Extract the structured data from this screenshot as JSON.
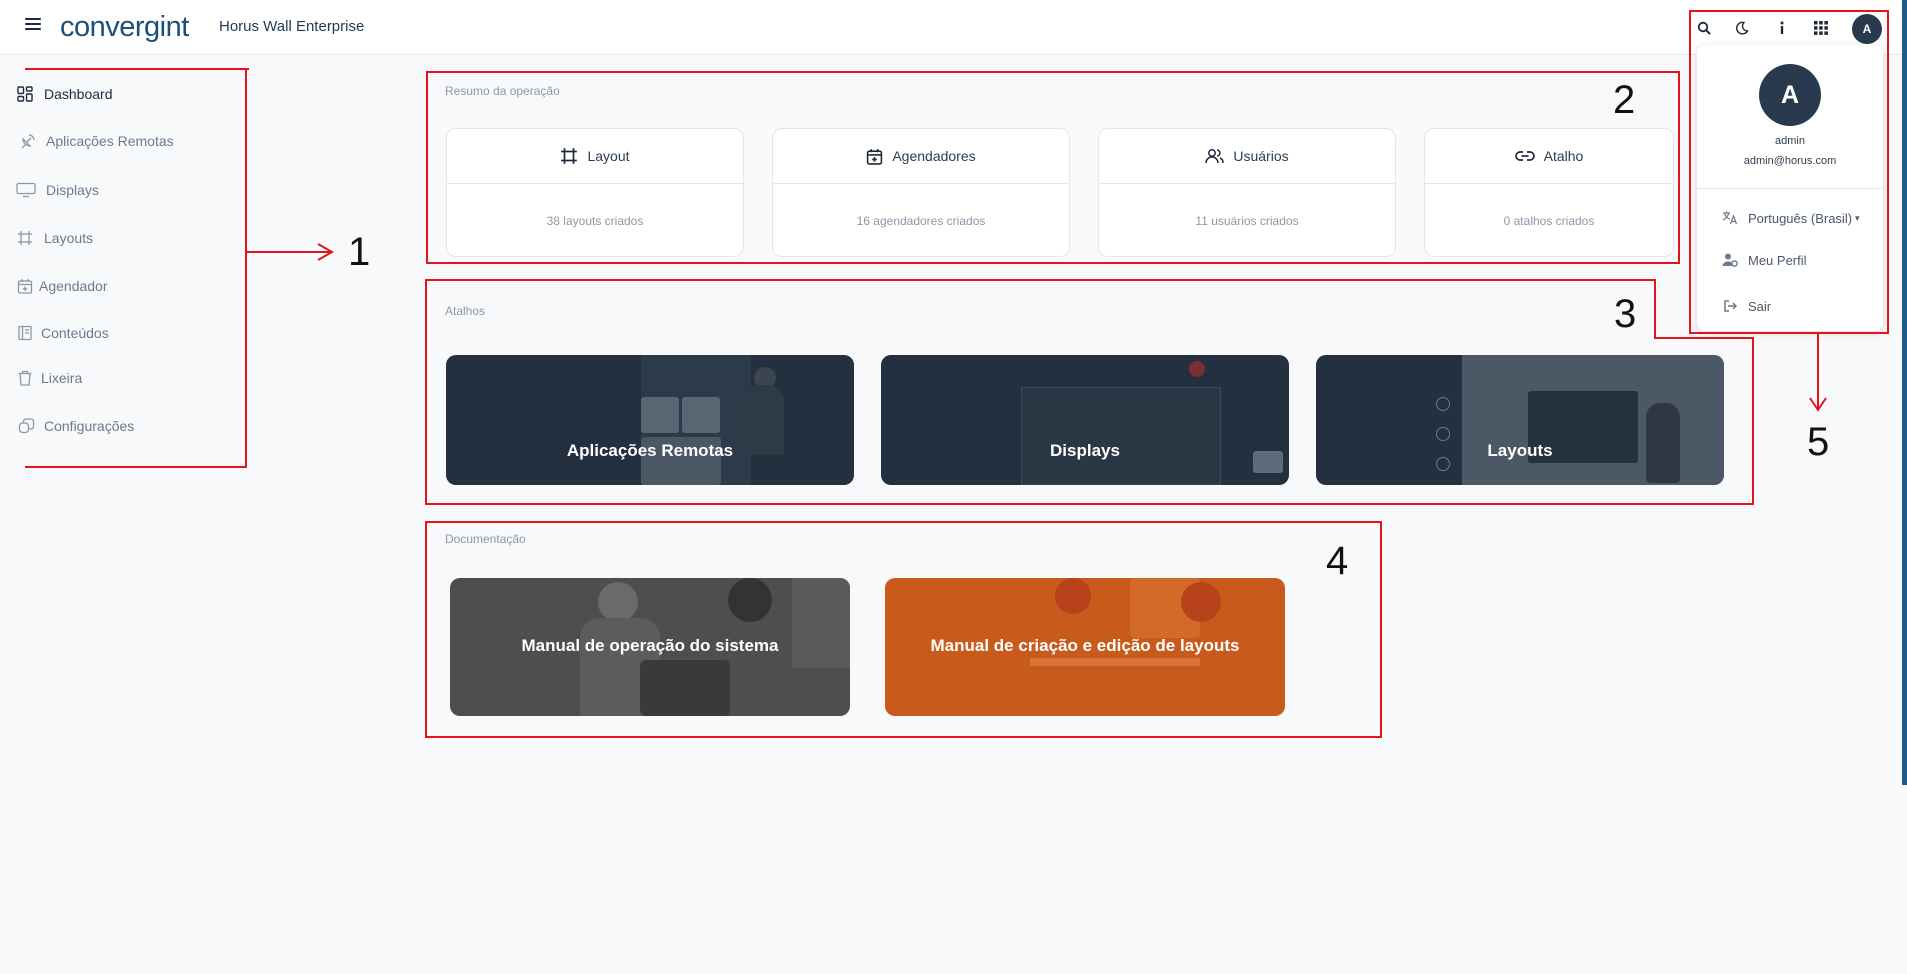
{
  "header": {
    "logo": "convergint",
    "app_title": "Horus Wall Enterprise",
    "avatar_initial": "A"
  },
  "sidebar": {
    "items": [
      {
        "label": "Dashboard",
        "icon": "dashboard-icon"
      },
      {
        "label": "Aplicações Remotas",
        "icon": "satellite-dish-icon"
      },
      {
        "label": "Displays",
        "icon": "monitor-icon"
      },
      {
        "label": "Layouts",
        "icon": "frame-icon"
      },
      {
        "label": "Agendador",
        "icon": "calendar-plus-icon"
      },
      {
        "label": "Conteúdos",
        "icon": "book-icon"
      },
      {
        "label": "Lixeira",
        "icon": "trash-icon"
      },
      {
        "label": "Configurações",
        "icon": "copy-icon"
      }
    ]
  },
  "summary": {
    "section_label": "Resumo da operação",
    "cards": [
      {
        "title": "Layout",
        "count_text": "38 layouts criados",
        "icon": "frame-icon"
      },
      {
        "title": "Agendadores",
        "count_text": "16 agendadores criados",
        "icon": "calendar-plus-icon"
      },
      {
        "title": "Usuários",
        "count_text": "11 usuários criados",
        "icon": "users-icon"
      },
      {
        "title": "Atalho",
        "count_text": "0 atalhos criados",
        "icon": "link-icon"
      }
    ]
  },
  "shortcuts": {
    "section_label": "Atalhos",
    "cards": [
      {
        "title": "Aplicações Remotas"
      },
      {
        "title": "Displays"
      },
      {
        "title": "Layouts"
      }
    ]
  },
  "docs": {
    "section_label": "Documentação",
    "cards": [
      {
        "title": "Manual de operação do sistema",
        "color": "#4e4e4e"
      },
      {
        "title": "Manual de criação e edição de layouts",
        "color": "#c85a1c"
      }
    ]
  },
  "user_menu": {
    "avatar_initial": "A",
    "name": "admin",
    "email": "admin@horus.com",
    "language": "Português (Brasil)",
    "profile_label": "Meu Perfil",
    "logout_label": "Sair"
  },
  "annotations": [
    "1",
    "2",
    "3",
    "4",
    "5"
  ],
  "colors": {
    "annotation_red": "#e3141b",
    "dark_card": "#24303f",
    "accent_navy": "#1d4f77"
  }
}
